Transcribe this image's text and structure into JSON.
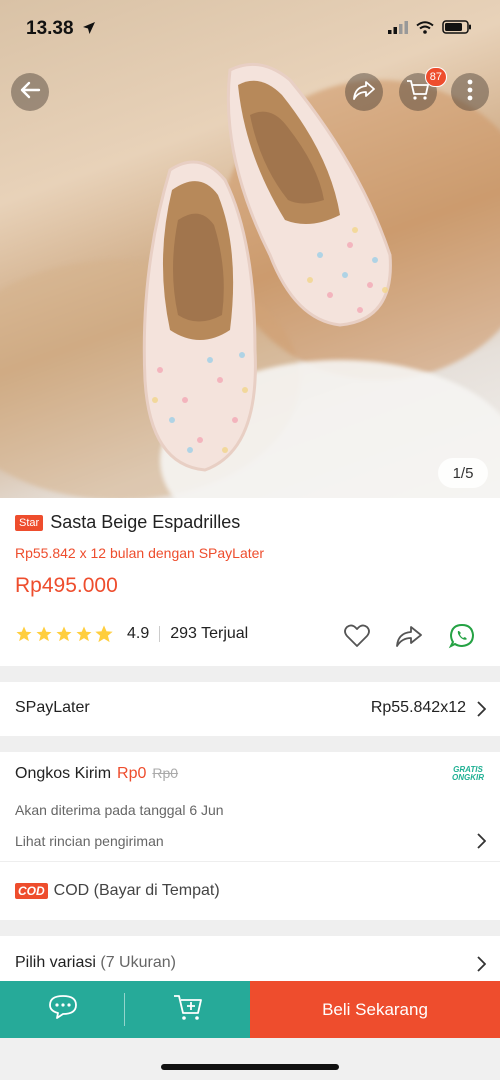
{
  "status_bar": {
    "time": "13.38",
    "icons": [
      "location-arrow-icon",
      "signal-icon",
      "wifi-icon",
      "battery-icon"
    ]
  },
  "header": {
    "back_icon": "back-arrow-icon",
    "share_icon": "share-icon",
    "cart_icon": "cart-icon",
    "cart_badge": "87",
    "more_icon": "more-vertical-icon"
  },
  "image": {
    "counter": "1/5"
  },
  "product": {
    "badge": "Star",
    "title": "Sasta Beige Espadrilles",
    "paylater_text": "Rp55.842 x 12 bulan dengan SPayLater",
    "price": "Rp495.000",
    "rating": "4.9",
    "rating_fraction": 0.98,
    "sold": "293 Terjual",
    "actions": [
      "heart-icon",
      "share-icon",
      "whatsapp-icon"
    ]
  },
  "spaylater": {
    "label": "SPayLater",
    "value": "Rp55.842x12"
  },
  "shipping": {
    "title": "Ongkos Kirim",
    "free_price": "Rp0",
    "old_price": "Rp0",
    "gratis_line1": "GRATIS",
    "gratis_line2": "ONGKIR",
    "date_text": "Akan diterima pada tanggal 6 Jun",
    "detail_text": "Lihat rincian pengiriman",
    "cod_badge": "COD",
    "cod_text": "COD (Bayar di Tempat)"
  },
  "variation": {
    "label": "Pilih variasi",
    "count": "(7 Ukuran)"
  },
  "bottom_bar": {
    "chat_icon": "chat-icon",
    "add_cart_icon": "add-to-cart-icon",
    "buy_label": "Beli Sekarang"
  },
  "colors": {
    "accent": "#ee4d2d",
    "teal": "#26aa99",
    "star": "#ffce3d",
    "whatsapp": "#25a244"
  }
}
